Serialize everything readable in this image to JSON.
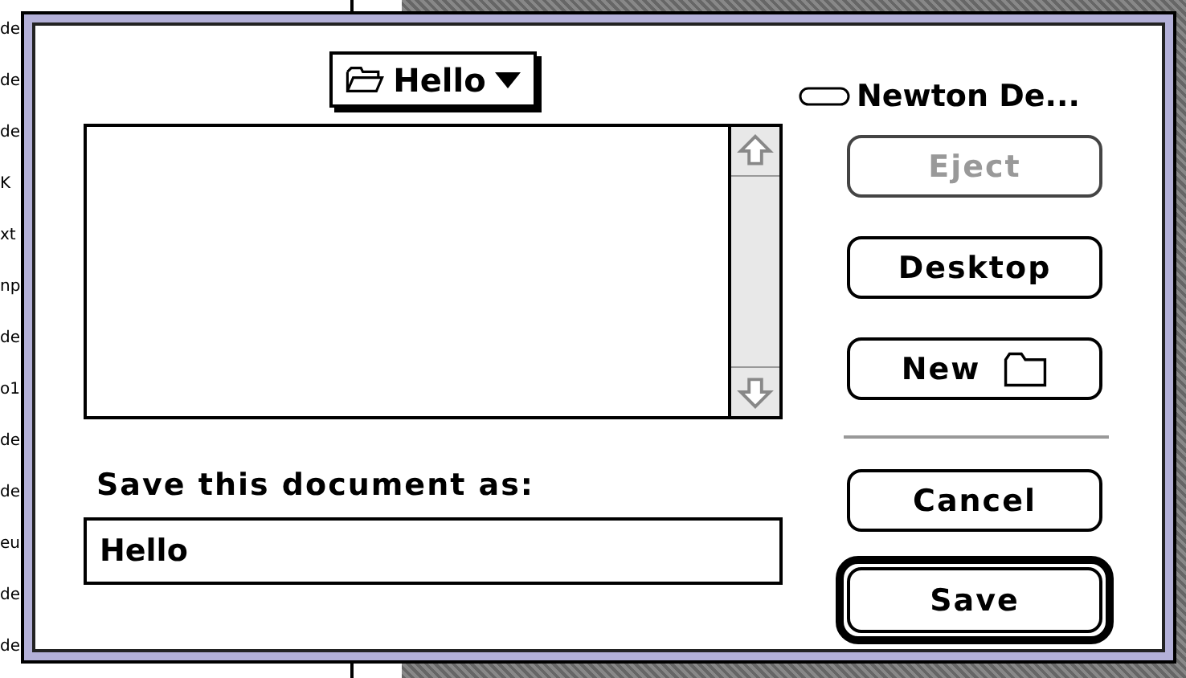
{
  "background_fragments": [
    "de",
    "de",
    "de",
    "K",
    "xt",
    "np",
    "de",
    "o1",
    "de",
    "de",
    "eu",
    "de",
    "de"
  ],
  "dialog": {
    "folder_popup": {
      "label": "Hello"
    },
    "volume": {
      "label": "Newton De..."
    },
    "buttons": [
      {
        "label": "Eject",
        "kind": "plain",
        "disabled": true,
        "default": false
      },
      {
        "label": "Desktop",
        "kind": "plain",
        "disabled": false,
        "default": false
      },
      {
        "label": "New",
        "kind": "new-folder",
        "disabled": false,
        "default": false
      },
      {
        "label": "Cancel",
        "kind": "plain",
        "disabled": false,
        "default": false
      },
      {
        "label": "Save",
        "kind": "plain",
        "disabled": false,
        "default": true
      }
    ],
    "save_field": {
      "prompt": "Save this document as:",
      "value": "Hello"
    }
  }
}
